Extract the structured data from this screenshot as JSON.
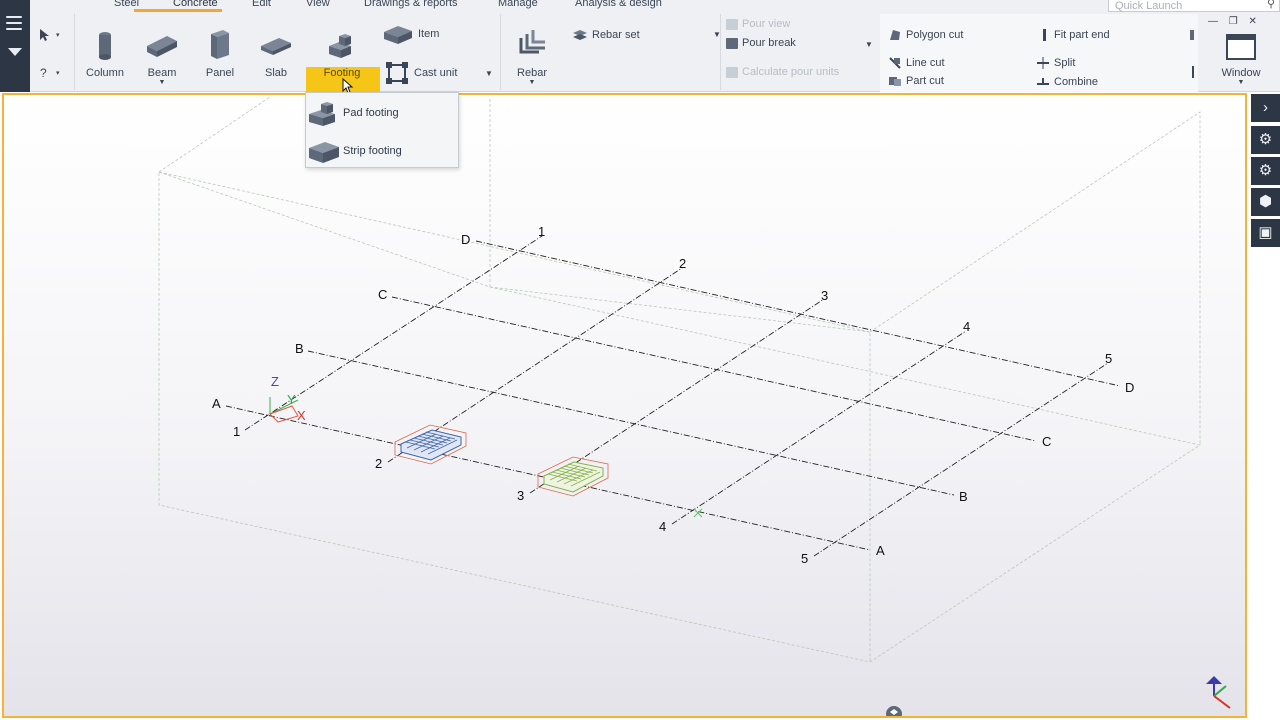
{
  "tabs": [
    "Steel",
    "Concrete",
    "Edit",
    "View",
    "Drawings & reports",
    "Manage",
    "Analysis & design"
  ],
  "active_tab": "Concrete",
  "quick_launch": {
    "placeholder": "Quick Launch"
  },
  "ribbon": {
    "column": "Column",
    "beam": "Beam",
    "panel": "Panel",
    "slab": "Slab",
    "footing": "Footing",
    "item": "Item",
    "cast_unit": "Cast unit",
    "rebar": "Rebar",
    "rebar_set": "Rebar set",
    "pour_view": "Pour view",
    "pour_break": "Pour break",
    "calculate_pour_units": "Calculate pour units",
    "polygon_cut": "Polygon cut",
    "line_cut": "Line cut",
    "part_cut": "Part cut",
    "fit_part_end": "Fit part end",
    "split": "Split",
    "combine": "Combine",
    "window": "Window"
  },
  "footing_menu": {
    "pad_footing": "Pad footing",
    "strip_footing": "Strip footing"
  },
  "viewport": {
    "grid_labels": {
      "letters": [
        "A",
        "B",
        "C",
        "D"
      ],
      "numbers": [
        "1",
        "2",
        "3",
        "4",
        "5"
      ]
    },
    "axis_labels": {
      "z": "Z",
      "y": "Y",
      "x": "X"
    }
  },
  "colors": {
    "accent": "#f5b335",
    "highlight": "#f5c518",
    "dark_bar": "#2c3645",
    "pad_footing_rebar": "#4a6fb3",
    "strip_footing_rebar": "#8fb64e"
  }
}
